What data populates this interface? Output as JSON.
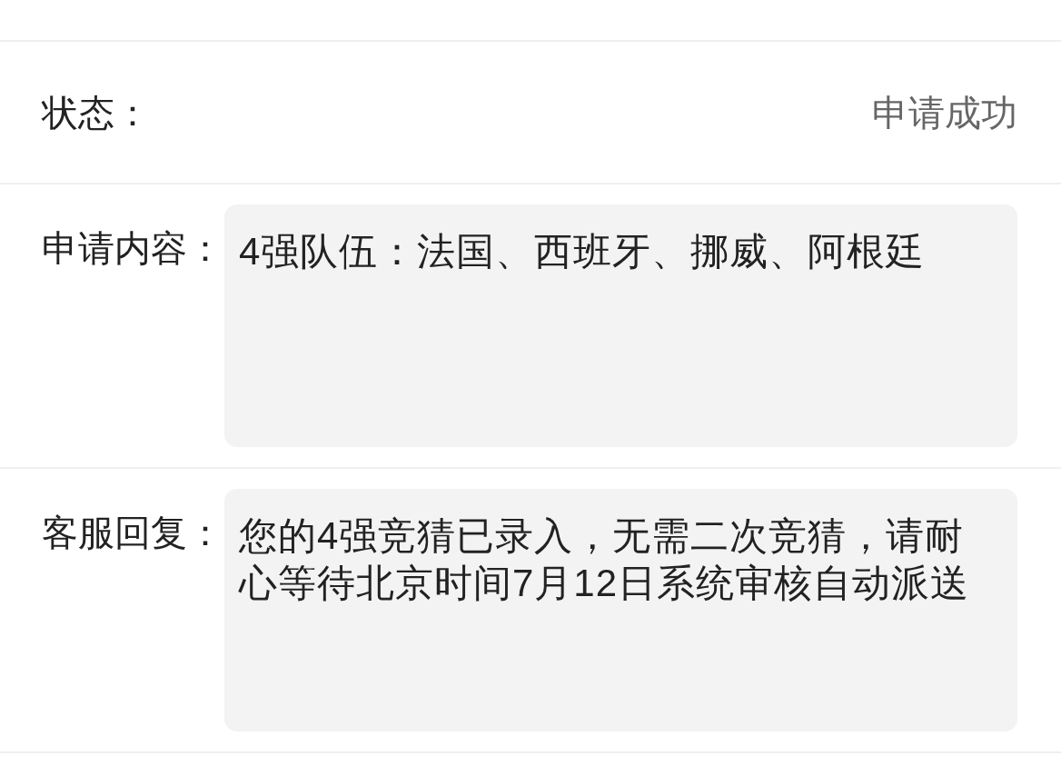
{
  "status": {
    "label": "状态：",
    "value": "申请成功"
  },
  "fields": [
    {
      "label": "申请内容：",
      "text": "4强队伍：法国、西班牙、挪威、阿根廷"
    },
    {
      "label": "客服回复：",
      "text": "您的4强竞猜已录入，无需二次竞猜，请耐心等待北京时间7月12日系统审核自动派送"
    }
  ]
}
